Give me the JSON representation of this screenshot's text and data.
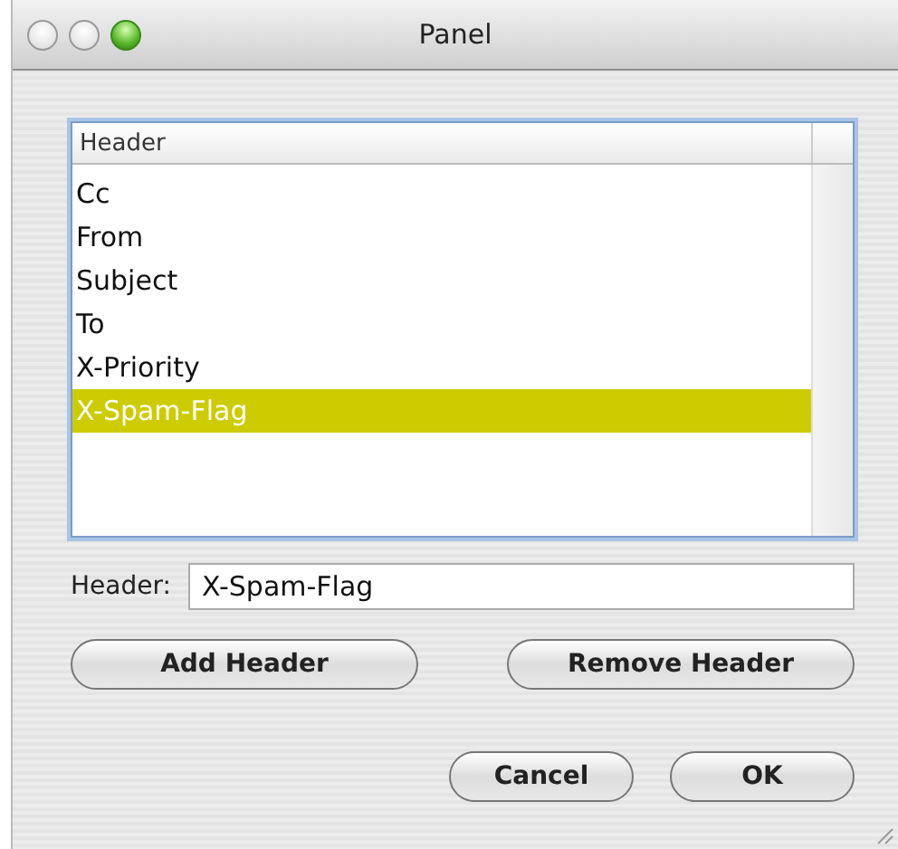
{
  "window": {
    "title": "Panel"
  },
  "traffic_lights": [
    {
      "kind": "inactive"
    },
    {
      "kind": "inactive"
    },
    {
      "kind": "zoom"
    }
  ],
  "list": {
    "column": "Header",
    "rows": [
      {
        "label": "Cc",
        "selected": false
      },
      {
        "label": "From",
        "selected": false
      },
      {
        "label": "Subject",
        "selected": false
      },
      {
        "label": "To",
        "selected": false
      },
      {
        "label": "X-Priority",
        "selected": false
      },
      {
        "label": "X-Spam-Flag",
        "selected": true
      }
    ]
  },
  "header_field": {
    "label": "Header:",
    "value": "X-Spam-Flag"
  },
  "list_buttons": [
    "Add Header",
    "Remove Header"
  ],
  "dialog_buttons": [
    "Cancel",
    "OK"
  ]
}
